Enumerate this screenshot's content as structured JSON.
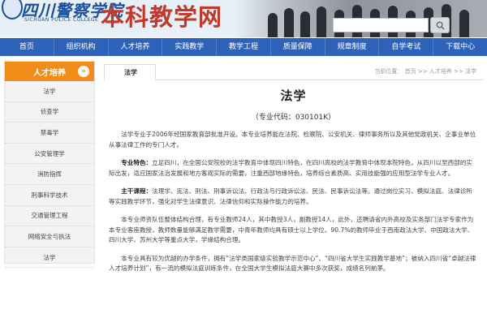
{
  "header": {
    "logo_text": "四川警察学院",
    "logo_en": "SICHUAN POLICE COLLEGE",
    "site_title": "本科教学网",
    "search": {
      "placeholder": ""
    }
  },
  "nav": {
    "items": [
      "首页",
      "组织机构",
      "人才培养",
      "实践教学",
      "教学工程",
      "质量保障",
      "规章制度",
      "自学考试",
      "下载中心"
    ]
  },
  "sidebar": {
    "title": "人才培养",
    "arrow": "»",
    "items": [
      "法学",
      "侦查学",
      "禁毒学",
      "公安管理学",
      "消防指挥",
      "刑事科学技术",
      "交通管理工程",
      "网络安全与执法",
      "法学"
    ]
  },
  "main": {
    "tab": "法学",
    "breadcrumb": "当前位置：  首页  >>  人才培养  >>  法学",
    "title": "法学",
    "code": "（专业代码：030101K）",
    "paragraphs": {
      "p1": "法学专业于2006年经国家教育部批准开设。本专业培养能在法院、检察院、公安机关、律师事务所以及其他党政机关、企事业单位从事法律工作的专门人才。",
      "p2_label": "专业特色：",
      "p2": "立足四川，在全国公安院校的法学教育中体现四川特色，在四川高校的法学教育中体现本院特色，从四川以至西部的实际出发，适应国家法治发展和地方客观实际的需要，注重西部地缘特色，培养综合素质高、实用技能强的应用型法学专业人才。",
      "p3_label": "主干课程：",
      "p3": "法理学、宪法、刑法、刑事诉讼法、行政法与行政诉讼法、民法、民事诉讼法等。通过岗位实习、模拟法庭、法律诊所等实践教学环节，强化对学生法律意识、法律信仰和实际操作能力的培养。",
      "p4": "本专业师资队伍整体结构合理，有专业教师24人，其中教授3人，副教授14人，此外，还聘请省内外高校及实务部门法学专家作为本专业客座教授，教师数量能够满足教学需要，中青年教师均具有硕士以上学位。90.7%的教师毕业于西南政法大学、中国政法大学、四川大学、苏州大学等重点大学，学缘结构合理。",
      "p5": "本专业具有较为优越的办学条件，拥有“法学类国家级实验教学示范中心”、“四川省大学生实践教学基地”；被纳入四川省“卓越法律人才培养计划”，有一流的模拟法庭训练条件，在全国大学生模拟法庭大赛中多次获奖，成绩名列前茅。"
    }
  }
}
